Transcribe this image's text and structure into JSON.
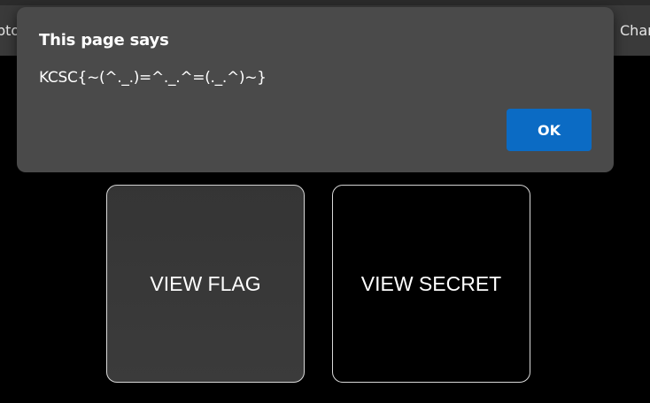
{
  "browser": {
    "left_tab_fragment": "pto",
    "right_tab_fragment": "Char"
  },
  "tiles": {
    "view_flag_label": "VIEW FLAG",
    "view_secret_label": "VIEW SECRET"
  },
  "dialog": {
    "title": "This page says",
    "message": "KCSC{~(^._.)=^._.^=(._.^)~}",
    "ok_label": "OK"
  },
  "colors": {
    "background": "#000000",
    "dialog_background": "#4a4a4a",
    "ok_button": "#0b6bc4",
    "tile_border": "#d9d9d9"
  }
}
